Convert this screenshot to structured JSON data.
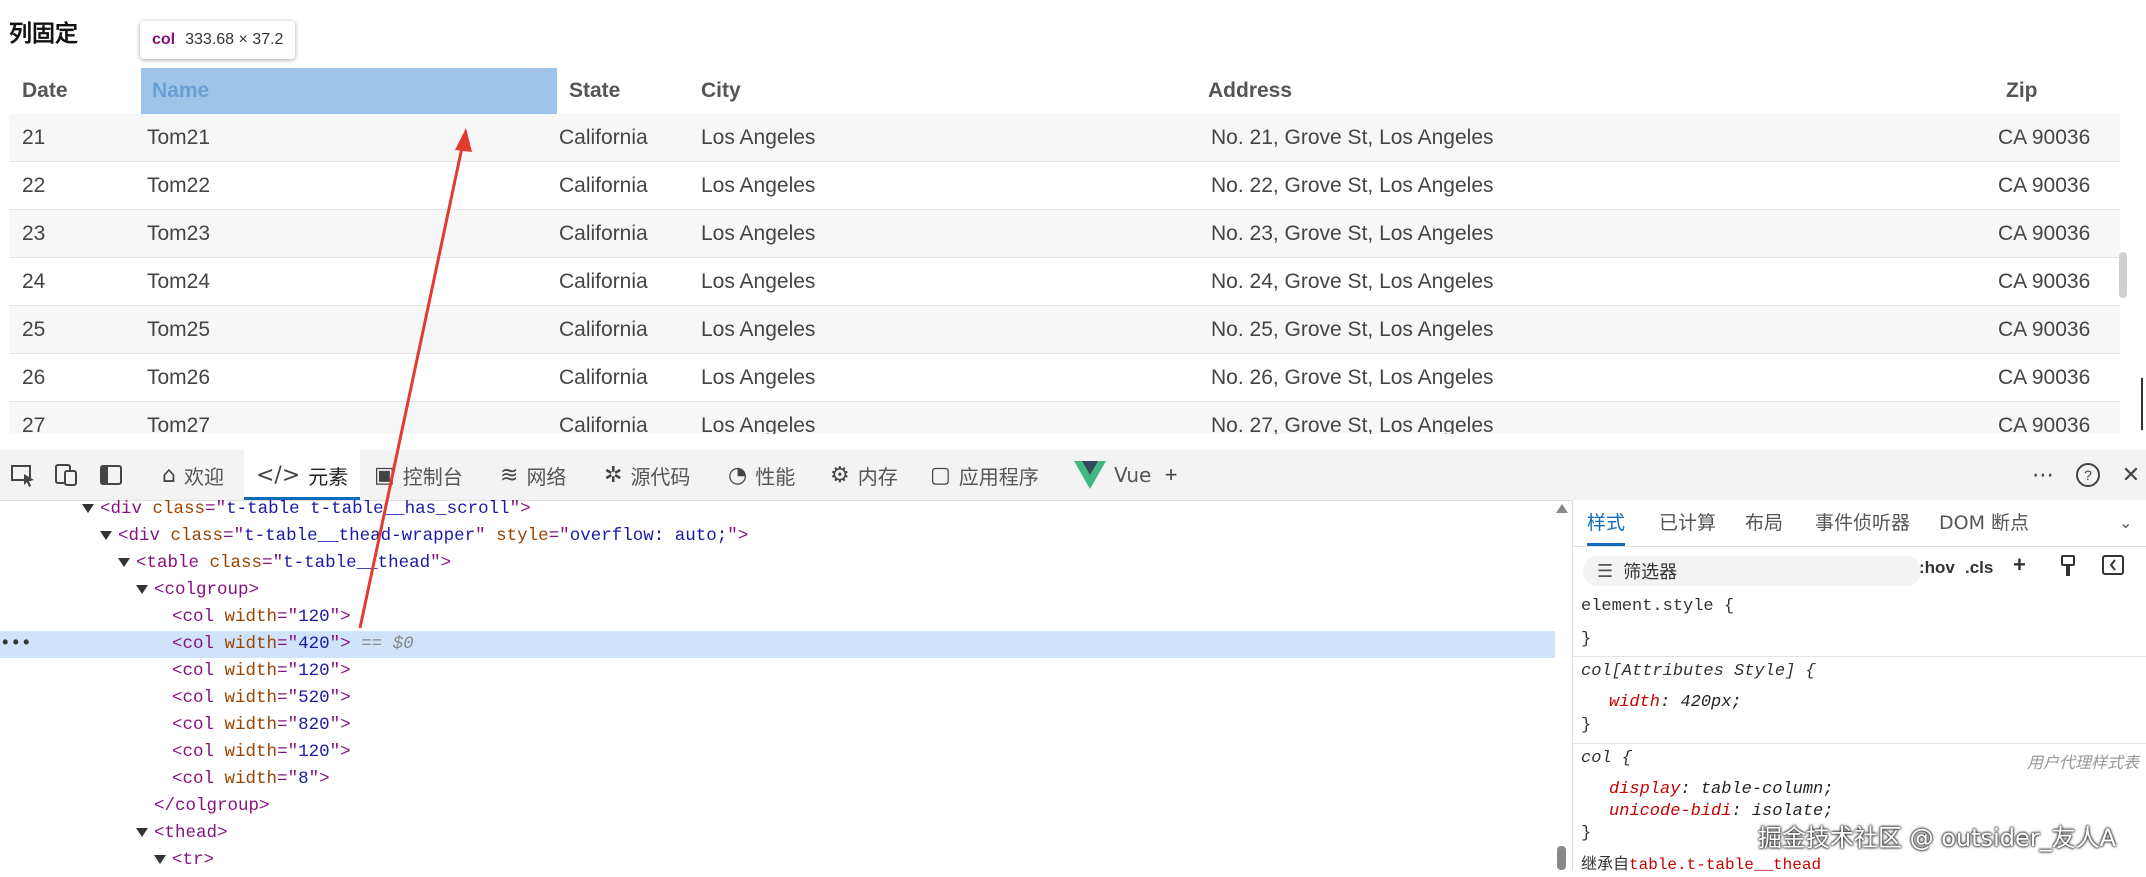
{
  "page": {
    "title": "列固定"
  },
  "tooltip": {
    "tag": "col",
    "dimensions": "333.68 × 37.2"
  },
  "table": {
    "columns": [
      "Date",
      "Name",
      "State",
      "City",
      "Address",
      "Zip"
    ],
    "rows": [
      [
        "21",
        "Tom21",
        "California",
        "Los Angeles",
        "No. 21, Grove St, Los Angeles",
        "CA 90036"
      ],
      [
        "22",
        "Tom22",
        "California",
        "Los Angeles",
        "No. 22, Grove St, Los Angeles",
        "CA 90036"
      ],
      [
        "23",
        "Tom23",
        "California",
        "Los Angeles",
        "No. 23, Grove St, Los Angeles",
        "CA 90036"
      ],
      [
        "24",
        "Tom24",
        "California",
        "Los Angeles",
        "No. 24, Grove St, Los Angeles",
        "CA 90036"
      ],
      [
        "25",
        "Tom25",
        "California",
        "Los Angeles",
        "No. 25, Grove St, Los Angeles",
        "CA 90036"
      ],
      [
        "26",
        "Tom26",
        "California",
        "Los Angeles",
        "No. 26, Grove St, Los Angeles",
        "CA 90036"
      ],
      [
        "27",
        "Tom27",
        "California",
        "Los Angeles",
        "No. 27, Grove St, Los Angeles",
        "CA 90036"
      ]
    ]
  },
  "devtools": {
    "tabs": [
      {
        "label": "欢迎",
        "icon": "home-icon"
      },
      {
        "label": "元素",
        "icon": "code-icon"
      },
      {
        "label": "控制台",
        "icon": "console-icon"
      },
      {
        "label": "网络",
        "icon": "wifi-icon"
      },
      {
        "label": "源代码",
        "icon": "bug-icon"
      },
      {
        "label": "性能",
        "icon": "performance-icon"
      },
      {
        "label": "内存",
        "icon": "memory-icon"
      },
      {
        "label": "应用程序",
        "icon": "application-icon"
      },
      {
        "label": "Vue",
        "icon": "vue-logo"
      }
    ],
    "active_tab": "元素",
    "elements": {
      "lines": {
        "l0": {
          "tag": "div",
          "attr": "class",
          "val": "t-table t-table__has_scroll"
        },
        "l1": {
          "tag": "div",
          "attr": "class",
          "val": "t-table__thead-wrapper",
          "attr2": "style",
          "val2": "overflow: auto;"
        },
        "l2": {
          "tag": "table",
          "attr": "class",
          "val": "t-table__thead"
        },
        "l3": {
          "tag": "colgroup"
        },
        "cols": [
          {
            "tag": "col",
            "attr": "width",
            "val": "120"
          },
          {
            "tag": "col",
            "attr": "width",
            "val": "420",
            "dollar": "== $0"
          },
          {
            "tag": "col",
            "attr": "width",
            "val": "120"
          },
          {
            "tag": "col",
            "attr": "width",
            "val": "520"
          },
          {
            "tag": "col",
            "attr": "width",
            "val": "820"
          },
          {
            "tag": "col",
            "attr": "width",
            "val": "120"
          },
          {
            "tag": "col",
            "attr": "width",
            "val": "8"
          }
        ],
        "close_colgroup": "</colgroup>",
        "thead": "thead",
        "tr": "tr"
      }
    },
    "styles": {
      "tabs": [
        "样式",
        "已计算",
        "布局",
        "事件侦听器",
        "DOM 断点"
      ],
      "filter_placeholder": "筛选器",
      "hov": ":hov",
      "cls": ".cls",
      "rules": {
        "element_style": "element.style {",
        "close": "}",
        "attr_selector": "col[Attributes Style] {",
        "attr_prop": "width",
        "attr_val": "420px;",
        "col_selector": "col {",
        "ua_label": "用户代理样式表",
        "col_prop1": "display",
        "col_val1": "table-column;",
        "col_prop2": "unicode-bidi",
        "col_val2": "isolate;",
        "inherited": "继承自",
        "inherited_from": "table.t-table__thead"
      }
    }
  },
  "watermark": "掘金技术社区 @ outsider_友人A",
  "colors": {
    "highlight": "#a0c4e8",
    "accent": "#0f6cbd",
    "arrow": "#e53a2e",
    "selected_line": "#cfe3fb"
  }
}
